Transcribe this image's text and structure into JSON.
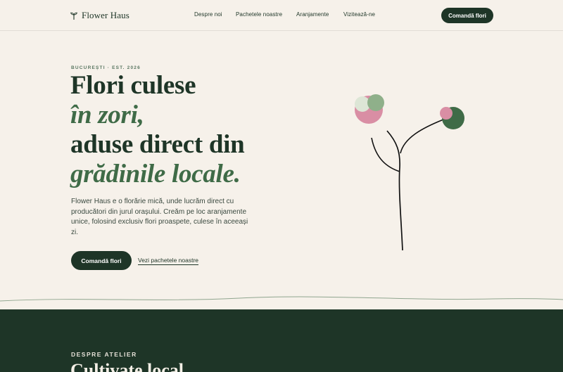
{
  "header": {
    "brand": "Flower Haus",
    "nav": [
      {
        "label": "Despre noi"
      },
      {
        "label": "Pachetele noastre"
      },
      {
        "label": "Aranjamente"
      },
      {
        "label": "Vizitează-ne"
      }
    ],
    "cta_label": "Comandă flori"
  },
  "hero": {
    "eyebrow": "BUCUREȘTI · EST. 2026",
    "headline": {
      "line1": "Flori culese",
      "line2": "în zori,",
      "line3": "aduse direct din",
      "line4": "grădinile locale."
    },
    "lede": "Flower Haus e o florărie mică, unde lucrăm direct cu producători din jurul orașului. Creăm pe loc aranjamente unice, folosind exclusiv flori proaspete, culese în aceeași zi.",
    "primary_cta": "Comandă flori",
    "secondary_link": "Vezi pachetele noastre"
  },
  "about": {
    "eyebrow": "DESPRE ATELIER",
    "title": "Cultivate local"
  },
  "colors": {
    "background": "#f6f1ea",
    "dark_green": "#1e3527",
    "accent_green": "#3f6b47",
    "pink": "#d98ea4",
    "sage": "#8fb08a",
    "mint": "#dde6d6"
  }
}
